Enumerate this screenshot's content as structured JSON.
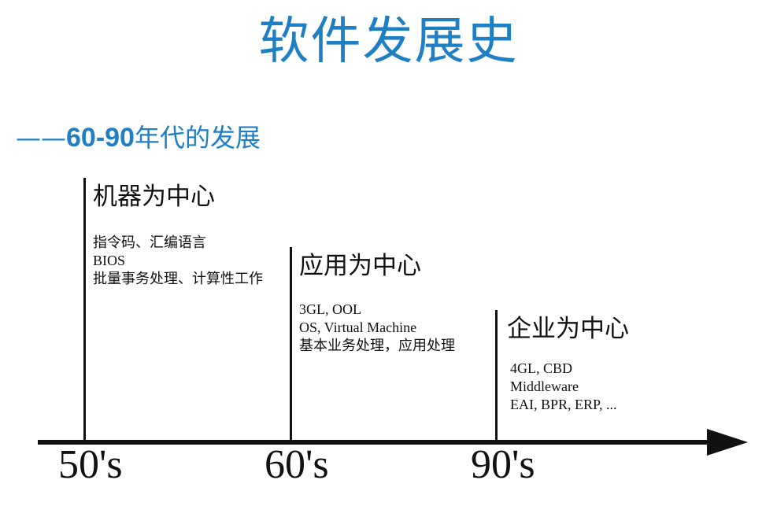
{
  "slide": {
    "title": "软件发展史",
    "subtitle_prefix": "——",
    "subtitle_bold": "60-90",
    "subtitle_suffix": "年代的发展"
  },
  "timeline": {
    "eras": [
      {
        "heading": "机器为中心",
        "lines": [
          "指令码、汇编语言",
          "BIOS",
          "批量事务处理、计算性工作"
        ]
      },
      {
        "heading": "应用为中心",
        "lines": [
          "3GL, OOL",
          "OS, Virtual Machine",
          "基本业务处理，应用处理"
        ]
      },
      {
        "heading": "企业为中心",
        "lines": [
          "4GL, CBD",
          "Middleware",
          "EAI, BPR, ERP, ..."
        ]
      }
    ],
    "tick_labels": [
      "50's",
      "60's",
      "90's"
    ]
  },
  "colors": {
    "accent": "#1f7fc4",
    "ink": "#111111"
  }
}
